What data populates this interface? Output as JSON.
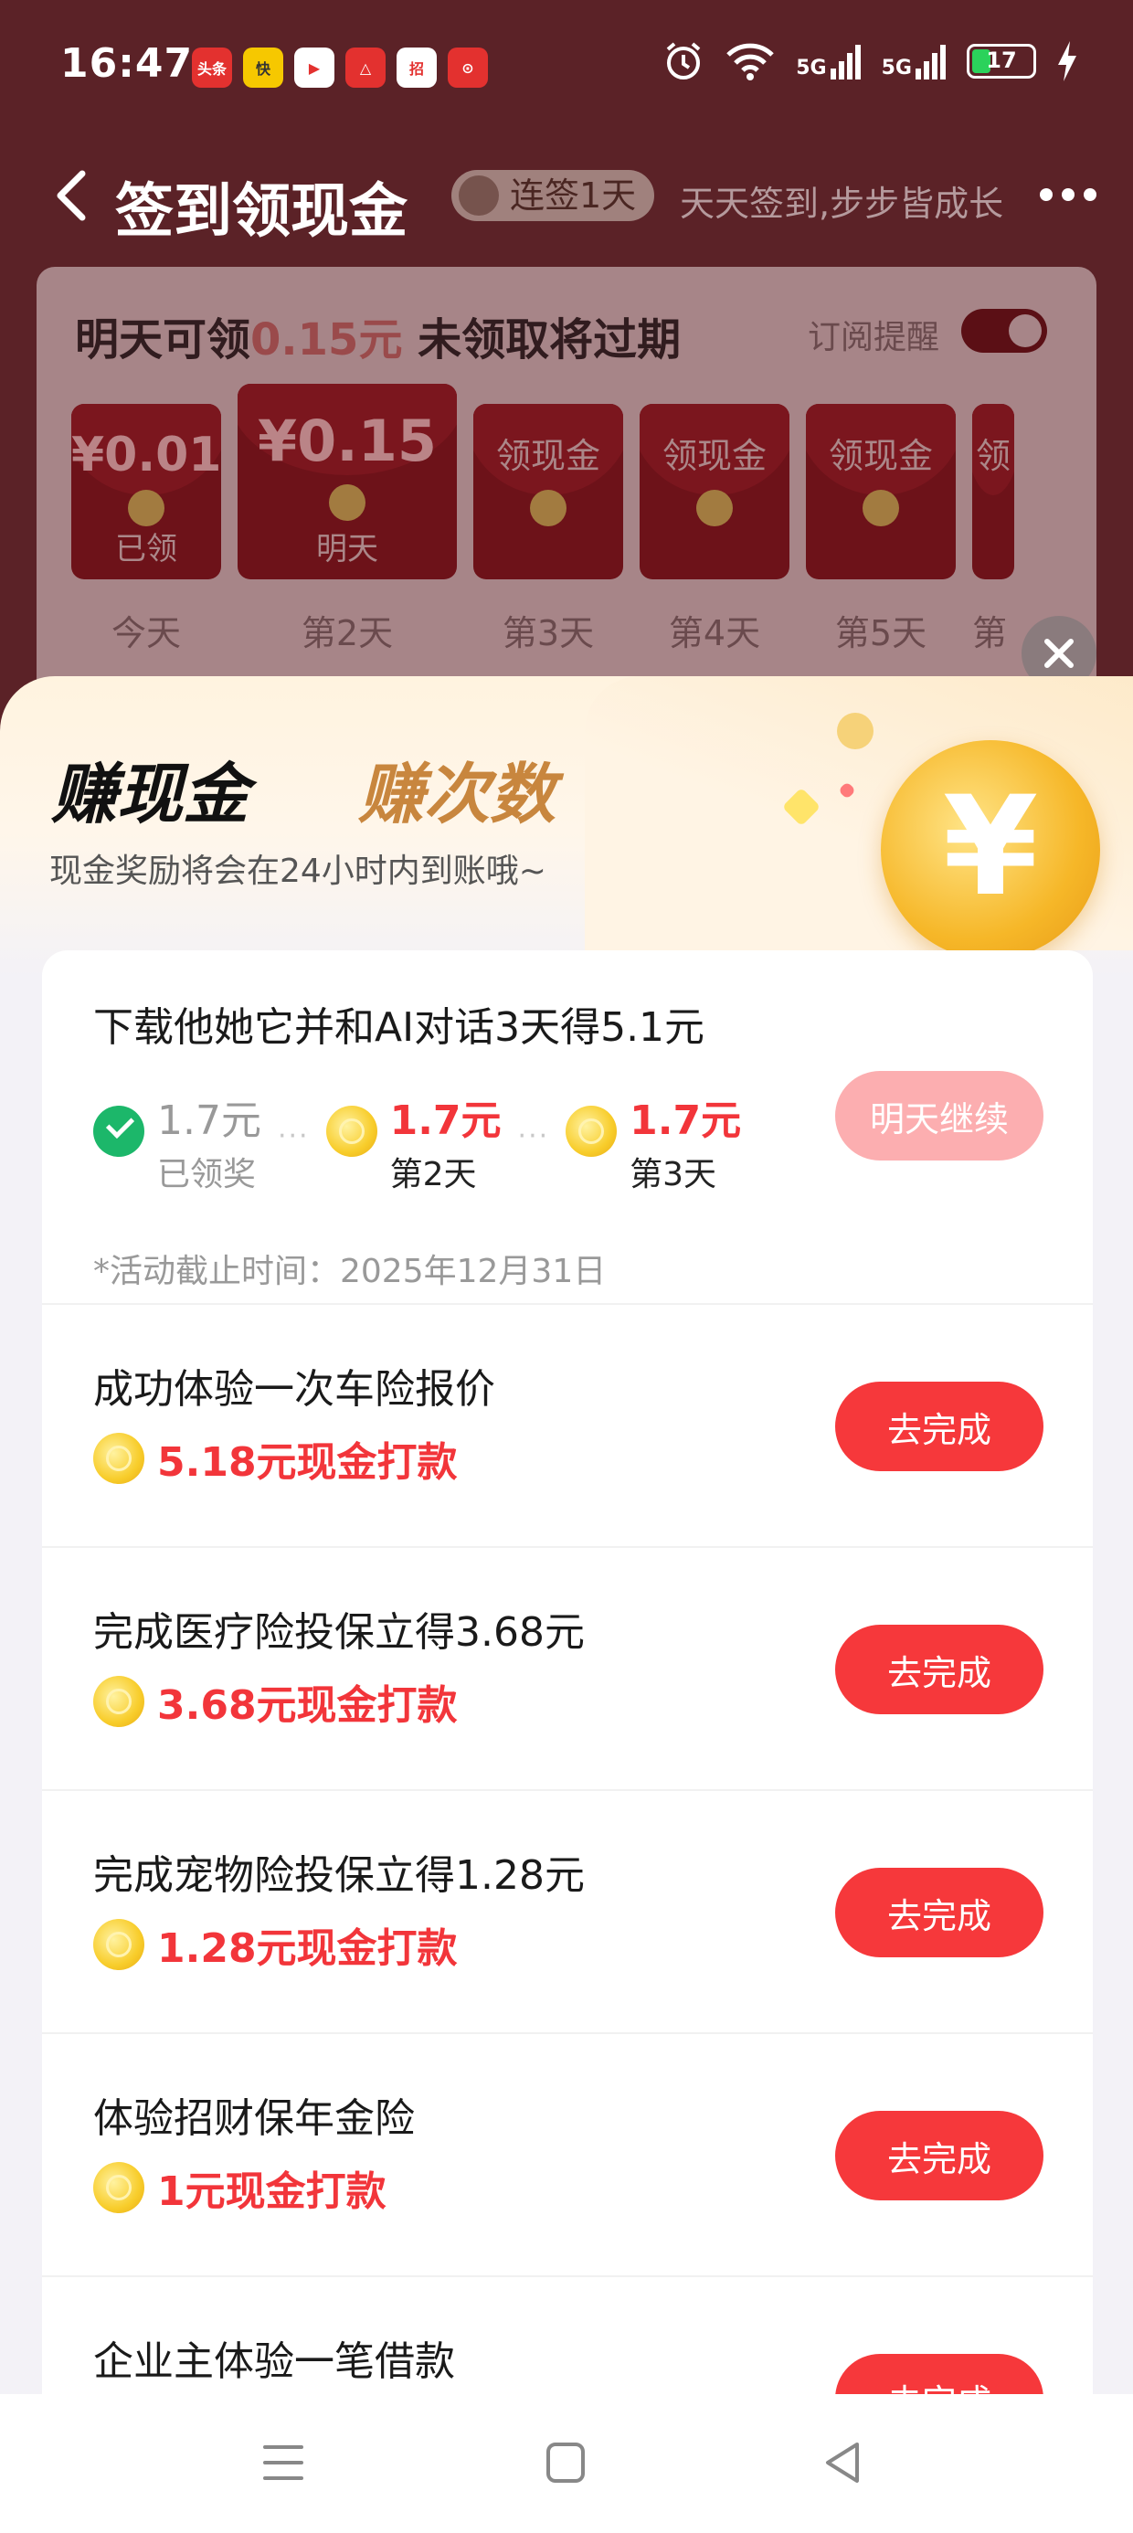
{
  "status_bar": {
    "time": "16:47",
    "notification_icons": [
      "头条",
      "快",
      "▶",
      "△",
      "招",
      "⊙"
    ],
    "signal_1": "5G",
    "signal_2": "5G",
    "battery": "17"
  },
  "header": {
    "title": "签到领现金",
    "streak_badge": "连签1天",
    "slogan": "天天签到,步步皆成长"
  },
  "checkin": {
    "title_prefix": "明天可领",
    "title_amount": "0.15元",
    "title_suffix": " 未领取将过期",
    "subscribe_label": "订阅提醒",
    "days": [
      {
        "amount": "¥0.01",
        "status": "已领",
        "label": "今天"
      },
      {
        "amount": "¥0.15",
        "status": "明天",
        "label": "第2天"
      },
      {
        "amount": "领现金",
        "status": "",
        "label": "第3天"
      },
      {
        "amount": "领现金",
        "status": "",
        "label": "第4天"
      },
      {
        "amount": "领现金",
        "status": "",
        "label": "第5天"
      },
      {
        "amount": "领",
        "status": "",
        "label": "第"
      }
    ]
  },
  "sheet": {
    "tab_active": "赚现金",
    "tab_inactive": "赚次数",
    "note": "现金奖励将会在24小时内到账哦~",
    "coin_symbol": "¥"
  },
  "tasks": {
    "first": {
      "title": "下载他她它并和AI对话3天得5.1元",
      "steps": [
        {
          "amount": "1.7元",
          "sub": "已领奖"
        },
        {
          "amount": "1.7元",
          "sub": "第2天"
        },
        {
          "amount": "1.7元",
          "sub": "第3天"
        }
      ],
      "deadline": "*活动截止时间：2025年12月31日",
      "button": "明天继续"
    },
    "items": [
      {
        "title": "成功体验一次车险报价",
        "reward": "5.18元现金打款",
        "button": "去完成"
      },
      {
        "title": "完成医疗险投保立得3.68元",
        "reward": "3.68元现金打款",
        "button": "去完成"
      },
      {
        "title": "完成宠物险投保立得1.28元",
        "reward": "1.28元现金打款",
        "button": "去完成"
      },
      {
        "title": "体验招财保年金险",
        "reward": "1元现金打款",
        "button": "去完成"
      },
      {
        "title": "企业主体验一笔借款",
        "reward": "",
        "button": "去完成"
      }
    ]
  }
}
